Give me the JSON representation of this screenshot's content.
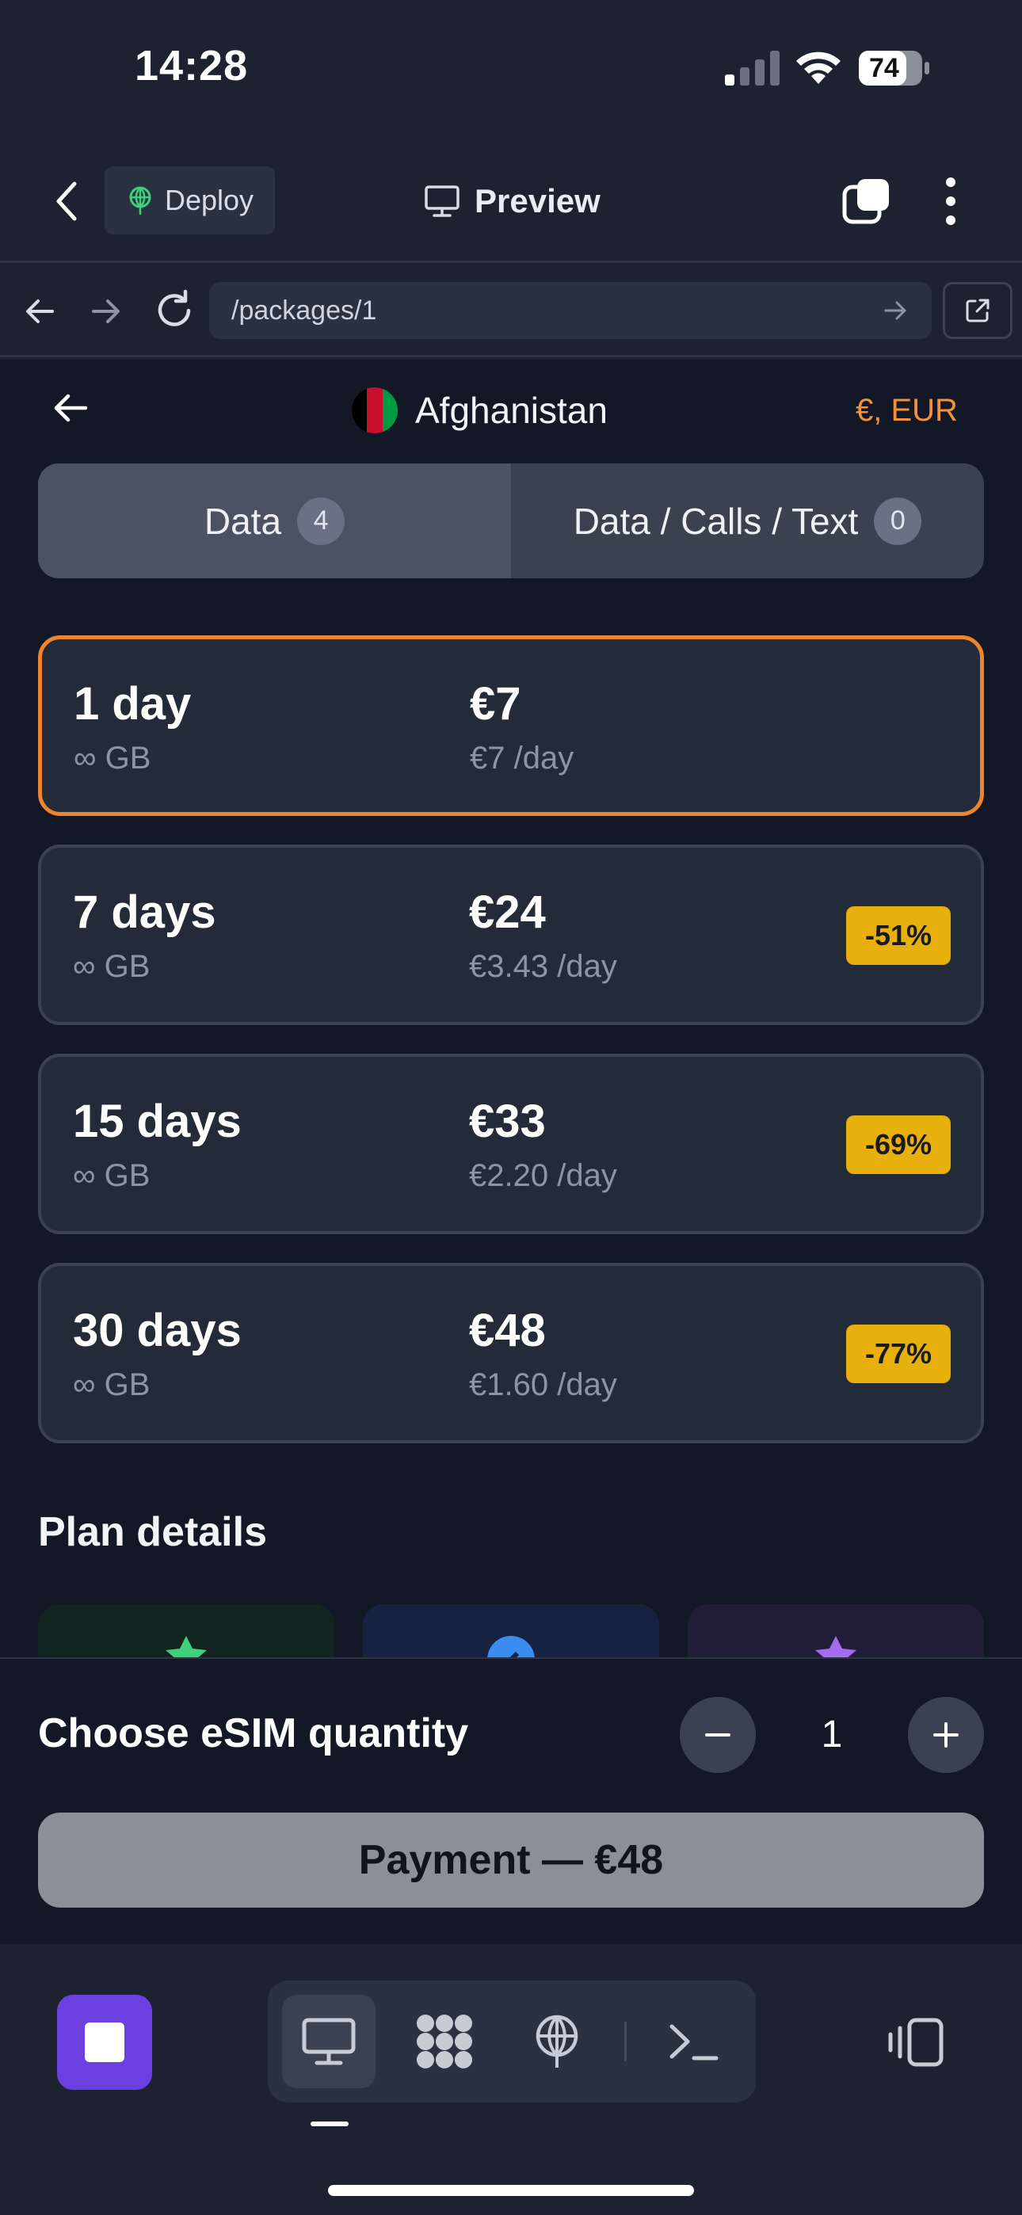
{
  "status_bar": {
    "time": "14:28",
    "battery": "74"
  },
  "app_bar": {
    "deploy_label": "Deploy",
    "preview_label": "Preview"
  },
  "browser": {
    "url": "/packages/1"
  },
  "header": {
    "country": "Afghanistan",
    "currency": "€, EUR"
  },
  "segments": [
    {
      "label": "Data",
      "count": "4"
    },
    {
      "label": "Data / Calls / Text",
      "count": "0"
    }
  ],
  "packages": [
    {
      "duration": "1 day",
      "data": "∞ GB",
      "price": "€7",
      "per_day": "€7 /day",
      "discount": ""
    },
    {
      "duration": "7 days",
      "data": "∞ GB",
      "price": "€24",
      "per_day": "€3.43 /day",
      "discount": "-51%"
    },
    {
      "duration": "15 days",
      "data": "∞ GB",
      "price": "€33",
      "per_day": "€2.20 /day",
      "discount": "-69%"
    },
    {
      "duration": "30 days",
      "data": "∞ GB",
      "price": "€48",
      "per_day": "€1.60 /day",
      "discount": "-77%"
    }
  ],
  "plan_details": {
    "title": "Plan details"
  },
  "quantity": {
    "label": "Choose eSIM quantity",
    "value": "1"
  },
  "payment": {
    "label": "Payment — €48"
  },
  "colors": {
    "accent": "#f0842c",
    "badge": "#e8b00c",
    "stop": "#6b3fe0"
  }
}
